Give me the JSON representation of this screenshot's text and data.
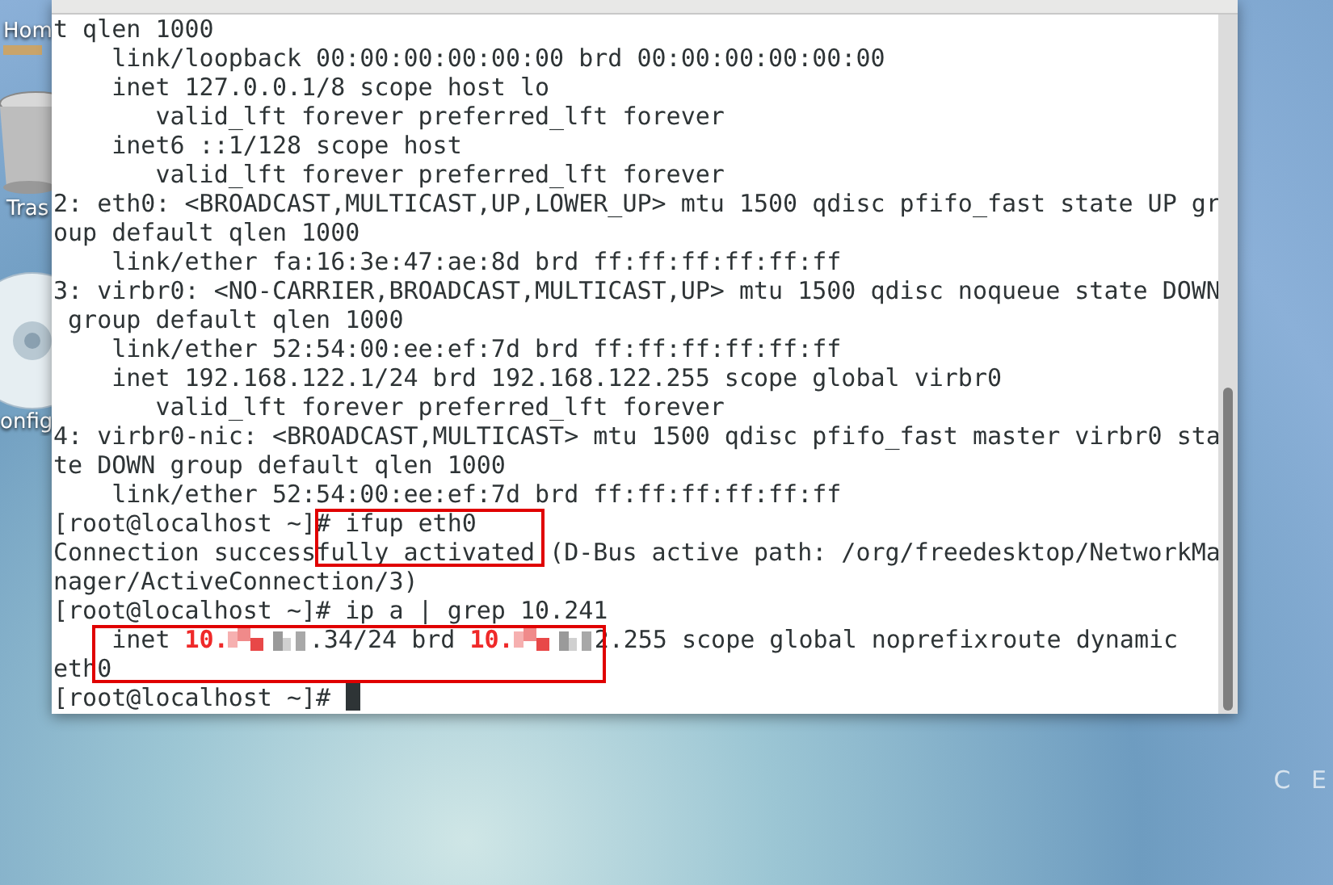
{
  "desktop_icons": [
    {
      "kind": "folder",
      "label": "Hom"
    },
    {
      "kind": "trash",
      "label": "Tras"
    },
    {
      "kind": "disc",
      "label": "onfig"
    }
  ],
  "desktop_logo_text": "C E",
  "terminal": {
    "lines": [
      {
        "text": "t qlen 1000"
      },
      {
        "text": "    link/loopback 00:00:00:00:00:00 brd 00:00:00:00:00:00"
      },
      {
        "text": "    inet 127.0.0.1/8 scope host lo"
      },
      {
        "text": "       valid_lft forever preferred_lft forever"
      },
      {
        "text": "    inet6 ::1/128 scope host"
      },
      {
        "text": "       valid_lft forever preferred_lft forever"
      },
      {
        "text": "2: eth0: <BROADCAST,MULTICAST,UP,LOWER_UP> mtu 1500 qdisc pfifo_fast state UP gr"
      },
      {
        "text": "oup default qlen 1000"
      },
      {
        "text": "    link/ether fa:16:3e:47:ae:8d brd ff:ff:ff:ff:ff:ff"
      },
      {
        "text": "3: virbr0: <NO-CARRIER,BROADCAST,MULTICAST,UP> mtu 1500 qdisc noqueue state DOWN"
      },
      {
        "text": " group default qlen 1000"
      },
      {
        "text": "    link/ether 52:54:00:ee:ef:7d brd ff:ff:ff:ff:ff:ff"
      },
      {
        "text": "    inet 192.168.122.1/24 brd 192.168.122.255 scope global virbr0"
      },
      {
        "text": "       valid_lft forever preferred_lft forever"
      },
      {
        "text": "4: virbr0-nic: <BROADCAST,MULTICAST> mtu 1500 qdisc pfifo_fast master virbr0 sta"
      },
      {
        "text": "te DOWN group default qlen 1000"
      },
      {
        "text": "    link/ether 52:54:00:ee:ef:7d brd ff:ff:ff:ff:ff:ff"
      },
      {
        "text": "[root@localhost ~]# ifup eth0"
      },
      {
        "text": "Connection successfully activated (D-Bus active path: /org/freedesktop/NetworkMa"
      },
      {
        "text": "nager/ActiveConnection/3)"
      },
      {
        "text": "[root@localhost ~]# ip a | grep 10.241"
      },
      {
        "segments": [
          {
            "kind": "plain",
            "text": "    inet "
          },
          {
            "kind": "highlight",
            "text": "10."
          },
          {
            "kind": "redacted"
          },
          {
            "kind": "plain",
            "text": ".34/24 brd "
          },
          {
            "kind": "highlight",
            "text": "10."
          },
          {
            "kind": "redacted"
          },
          {
            "kind": "plain",
            "text": "2.255 scope global noprefixroute dynamic"
          }
        ]
      },
      {
        "text": "eth0"
      },
      {
        "text": "[root@localhost ~]# ",
        "cursor": true
      }
    ]
  }
}
